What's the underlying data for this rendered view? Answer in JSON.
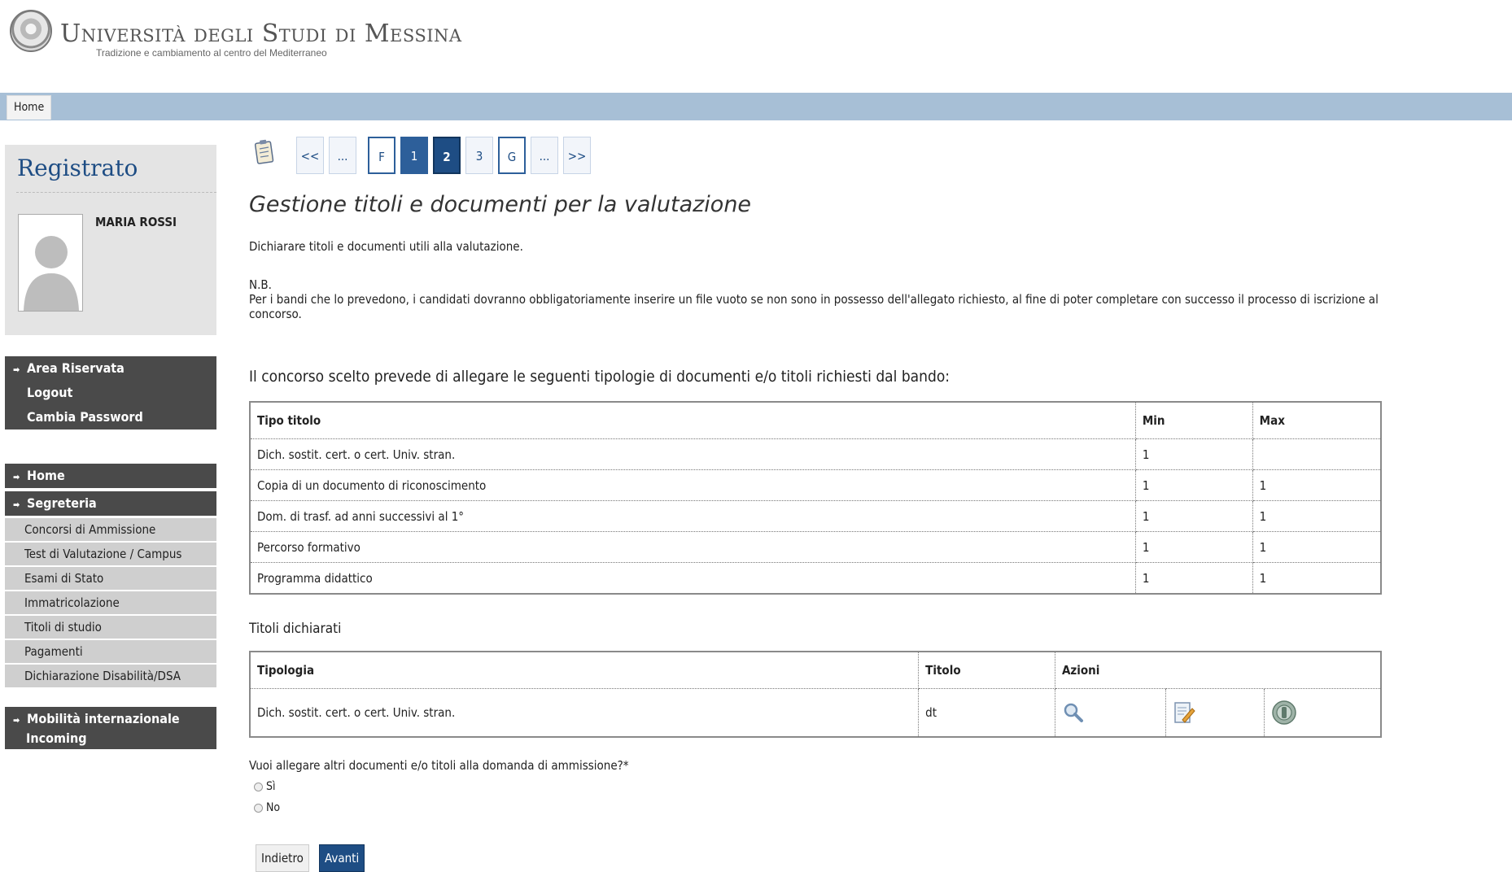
{
  "header": {
    "university_name": "Università degli Studi di Messina",
    "tagline": "Tradizione e cambiamento al centro del Mediterraneo",
    "home_tab": "Home"
  },
  "sidebar": {
    "title": "Registrato",
    "user_name": "MARIA ROSSI",
    "area_menu": [
      {
        "label": "Area Riservata",
        "arrow": true
      },
      {
        "label": "Logout",
        "arrow": false
      },
      {
        "label": "Cambia Password",
        "arrow": false
      }
    ],
    "home": "Home",
    "segreteria": "Segreteria",
    "segreteria_items": [
      "Concorsi di Ammissione",
      "Test di Valutazione / Campus",
      "Esami di Stato",
      "Immatricolazione",
      "Titoli di studio",
      "Pagamenti",
      "Dichiarazione Disabilità/DSA"
    ],
    "mobility_line1": "Mobilità internazionale",
    "mobility_line2": "Incoming"
  },
  "wizard": {
    "steps": [
      "<<",
      "...",
      "F",
      "1",
      "2",
      "3",
      "G",
      "...",
      ">>"
    ],
    "current": "2"
  },
  "main": {
    "title": "Gestione titoli e documenti per la valutazione",
    "intro": "Dichiarare titoli e documenti utili alla valutazione.",
    "nb_label": "N.B.",
    "nb_text": "Per i bandi che lo prevedono, i candidati dovranno obbligatoriamente inserire un file vuoto se non sono in possesso dell'allegato richiesto, al fine di poter completare con successo il processo di iscrizione al concorso.",
    "required_heading": "Il concorso scelto prevede di allegare le seguenti tipologie di documenti e/o titoli richiesti dal bando:",
    "required_table": {
      "headers": [
        "Tipo titolo",
        "Min",
        "Max"
      ],
      "rows": [
        [
          "Dich. sostit. cert. o cert. Univ. stran.",
          "1",
          ""
        ],
        [
          "Copia di un documento di riconoscimento",
          "1",
          "1"
        ],
        [
          "Dom. di trasf. ad anni successivi al 1°",
          "1",
          "1"
        ],
        [
          "Percorso formativo",
          "1",
          "1"
        ],
        [
          "Programma didattico",
          "1",
          "1"
        ]
      ]
    },
    "declared_heading": "Titoli dichiarati",
    "declared_table": {
      "headers": [
        "Tipologia",
        "Titolo",
        "Azioni"
      ],
      "rows": [
        {
          "tipologia": "Dich. sostit. cert. o cert. Univ. stran.",
          "titolo": "dt",
          "actions": [
            "view-icon",
            "edit-icon",
            "delete-icon"
          ]
        }
      ]
    },
    "question": "Vuoi allegare altri documenti e/o titoli alla domanda di ammissione?*",
    "options": [
      "Sì",
      "No"
    ],
    "back_button": "Indietro",
    "next_button": "Avanti"
  },
  "colors": {
    "topbar": "#a7bfd6",
    "brand_blue": "#1e4d84",
    "sidebar_dark": "#4a4a4a",
    "sidebar_light": "#cfcfcf"
  }
}
